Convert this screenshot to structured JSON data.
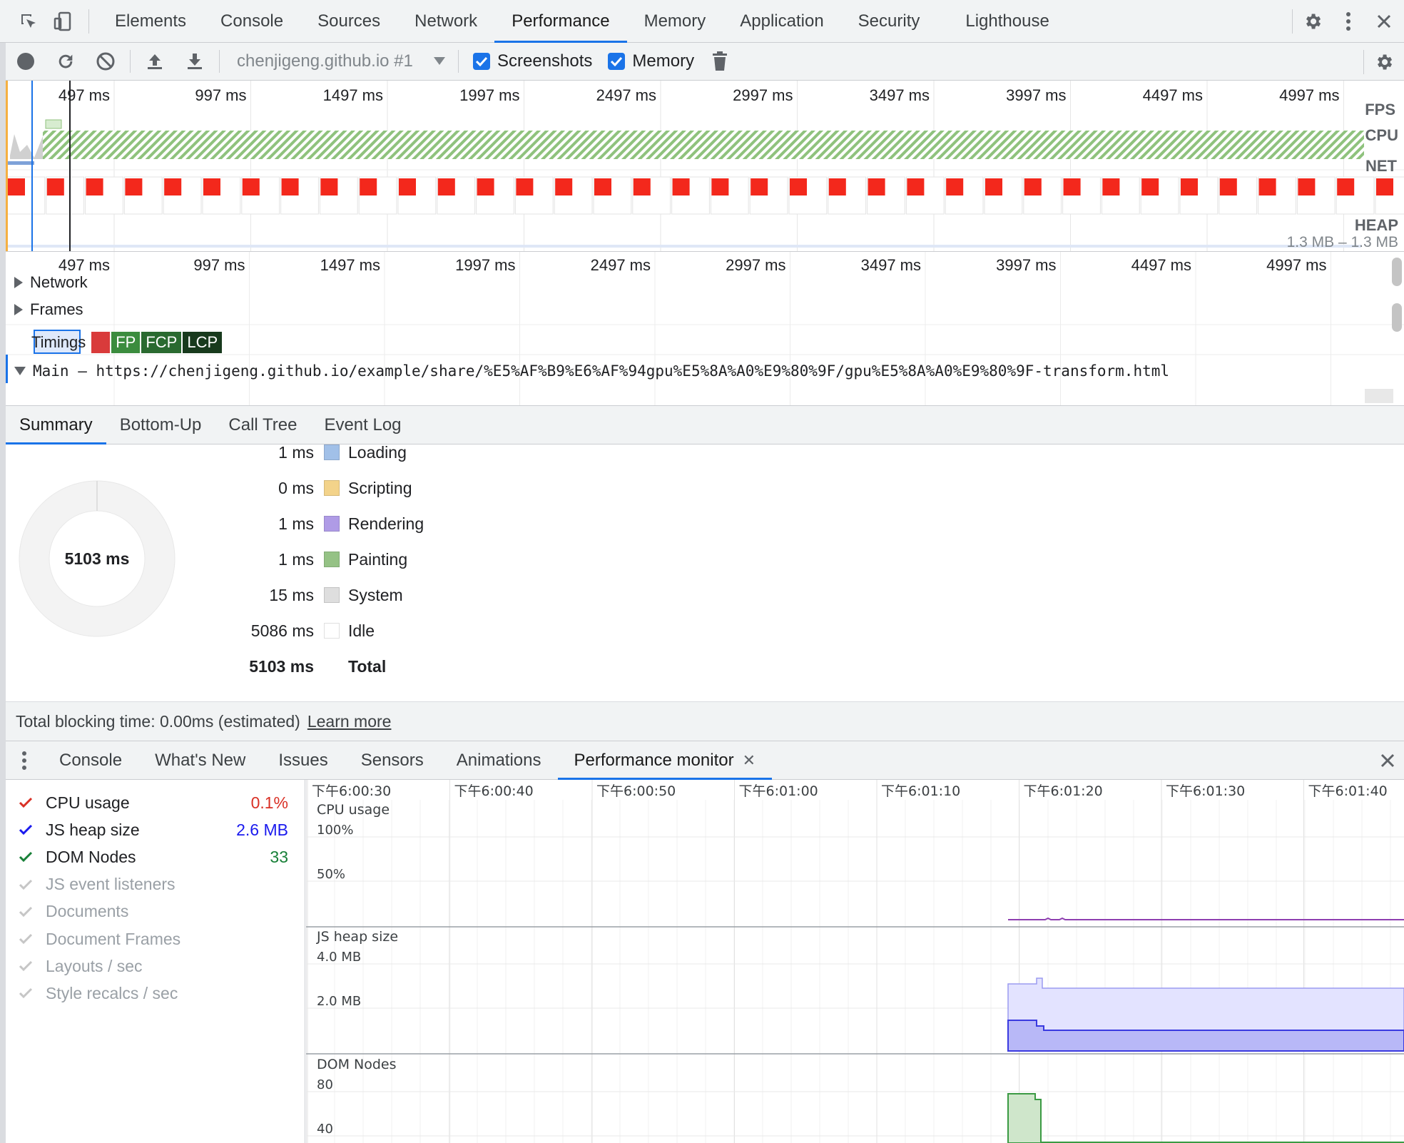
{
  "tabs": {
    "items": [
      "Elements",
      "Console",
      "Sources",
      "Network",
      "Performance",
      "Memory",
      "Application",
      "Security",
      "Lighthouse"
    ],
    "active": "Performance"
  },
  "toolbar": {
    "target": "chenjigeng.github.io #1",
    "screenshots_label": "Screenshots",
    "memory_label": "Memory",
    "screenshots_checked": true,
    "memory_checked": true
  },
  "overview": {
    "ticks": [
      "497 ms",
      "997 ms",
      "1497 ms",
      "1997 ms",
      "2497 ms",
      "2997 ms",
      "3497 ms",
      "3997 ms",
      "4497 ms",
      "4997 ms"
    ],
    "labels": {
      "fps": "FPS",
      "cpu": "CPU",
      "net": "NET",
      "heap": "HEAP"
    },
    "heap_range": "1.3 MB – 1.3 MB"
  },
  "flame": {
    "ticks": [
      "497 ms",
      "997 ms",
      "1497 ms",
      "1997 ms",
      "2497 ms",
      "2997 ms",
      "3497 ms",
      "3997 ms",
      "4497 ms",
      "4997 ms"
    ],
    "tracks": {
      "network": "Network",
      "frames": "Frames",
      "timings": "Timings",
      "main": "Main — https://chenjigeng.github.io/example/share/%E5%AF%B9%E6%AF%94gpu%E5%8A%A0%E9%80%9F/gpu%E5%8A%A0%E9%80%9F-transform.html"
    },
    "timing_badges": [
      "FP",
      "FCP",
      "LCP"
    ]
  },
  "details": {
    "tabs": [
      "Summary",
      "Bottom-Up",
      "Call Tree",
      "Event Log"
    ],
    "active": "Summary"
  },
  "summary": {
    "total": "5103 ms",
    "rows": [
      {
        "value": "1 ms",
        "label": "Loading",
        "color": "#a1c0e8"
      },
      {
        "value": "0 ms",
        "label": "Scripting",
        "color": "#f3d38a"
      },
      {
        "value": "1 ms",
        "label": "Rendering",
        "color": "#af9be6"
      },
      {
        "value": "1 ms",
        "label": "Painting",
        "color": "#95c285"
      },
      {
        "value": "15 ms",
        "label": "System",
        "color": "#dedede"
      },
      {
        "value": "5086 ms",
        "label": "Idle",
        "color": "#ffffff"
      }
    ],
    "total_row": {
      "value": "5103 ms",
      "label": "Total"
    },
    "tbt": "Total blocking time: 0.00ms (estimated)",
    "learn_more": "Learn more"
  },
  "drawer": {
    "tabs": [
      "Console",
      "What's New",
      "Issues",
      "Sensors",
      "Animations",
      "Performance monitor"
    ],
    "active": "Performance monitor"
  },
  "monitor": {
    "metrics": [
      {
        "label": "CPU usage",
        "value": "0.1%",
        "checked": true,
        "color": "#d93025"
      },
      {
        "label": "JS heap size",
        "value": "2.6 MB",
        "checked": true,
        "color": "#1a1aee"
      },
      {
        "label": "DOM Nodes",
        "value": "33",
        "checked": true,
        "color": "#188038"
      },
      {
        "label": "JS event listeners",
        "value": "",
        "checked": false,
        "color": "#c6c6c6"
      },
      {
        "label": "Documents",
        "value": "",
        "checked": false,
        "color": "#c6c6c6"
      },
      {
        "label": "Document Frames",
        "value": "",
        "checked": false,
        "color": "#c6c6c6"
      },
      {
        "label": "Layouts / sec",
        "value": "",
        "checked": false,
        "color": "#c6c6c6"
      },
      {
        "label": "Style recalcs / sec",
        "value": "",
        "checked": false,
        "color": "#c6c6c6"
      }
    ],
    "time_ticks": [
      "下午6:00:30",
      "下午6:00:40",
      "下午6:00:50",
      "下午6:01:00",
      "下午6:01:10",
      "下午6:01:20",
      "下午6:01:30",
      "下午6:01:40"
    ],
    "charts": [
      {
        "title": "CPU usage",
        "ticks": [
          "100%",
          "50%"
        ]
      },
      {
        "title": "JS heap size",
        "ticks": [
          "4.0 MB",
          "2.0 MB"
        ]
      },
      {
        "title": "DOM Nodes",
        "ticks": [
          "80",
          "40"
        ]
      }
    ]
  }
}
